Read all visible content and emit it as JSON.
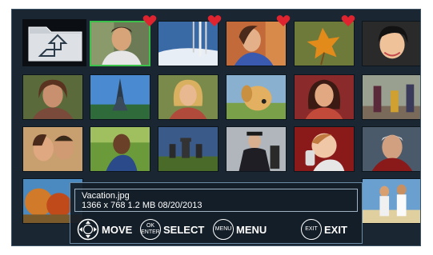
{
  "file": {
    "name": "Vacation.jpg",
    "meta": "1366 x 768   1.2 MB  08/20/2013"
  },
  "hints": [
    {
      "button": "",
      "label": "MOVE"
    },
    {
      "button_top": "OK",
      "button_bottom": "ENTER",
      "label": "SELECT"
    },
    {
      "button": "MENU",
      "label": "MENU"
    },
    {
      "button": "EXIT",
      "label": "EXIT"
    }
  ],
  "tiles": [
    {
      "name": "photo-young-man",
      "favorite": true,
      "selected": true
    },
    {
      "name": "photo-winter-birches",
      "favorite": true,
      "selected": false
    },
    {
      "name": "photo-woman-laughing",
      "favorite": true,
      "selected": false
    },
    {
      "name": "photo-autumn-leaf",
      "favorite": true,
      "selected": false
    },
    {
      "name": "photo-asian-girl",
      "favorite": false,
      "selected": false
    },
    {
      "name": "photo-woman-smiling",
      "favorite": false,
      "selected": false
    },
    {
      "name": "photo-eiffel-tower",
      "favorite": false,
      "selected": false
    },
    {
      "name": "photo-blonde-woman",
      "favorite": false,
      "selected": false
    },
    {
      "name": "photo-golden-retriever",
      "favorite": false,
      "selected": false
    },
    {
      "name": "photo-woman-portrait",
      "favorite": false,
      "selected": false
    },
    {
      "name": "photo-family-walking",
      "favorite": false,
      "selected": false
    },
    {
      "name": "photo-couple",
      "favorite": false,
      "selected": false
    },
    {
      "name": "photo-boy-field",
      "favorite": false,
      "selected": false
    },
    {
      "name": "photo-stonehenge",
      "favorite": false,
      "selected": false
    },
    {
      "name": "photo-businessman",
      "favorite": false,
      "selected": false
    },
    {
      "name": "photo-baby-phone",
      "favorite": false,
      "selected": false
    },
    {
      "name": "photo-old-man",
      "favorite": false,
      "selected": false
    },
    {
      "name": "photo-autumn-trees",
      "favorite": false,
      "selected": false
    },
    {
      "name": "photo-beach-girls",
      "favorite": false,
      "selected": false
    }
  ],
  "colors": {
    "background": "#1a2733",
    "selected_border": "#3cc24a",
    "heart": "#e0242f"
  }
}
